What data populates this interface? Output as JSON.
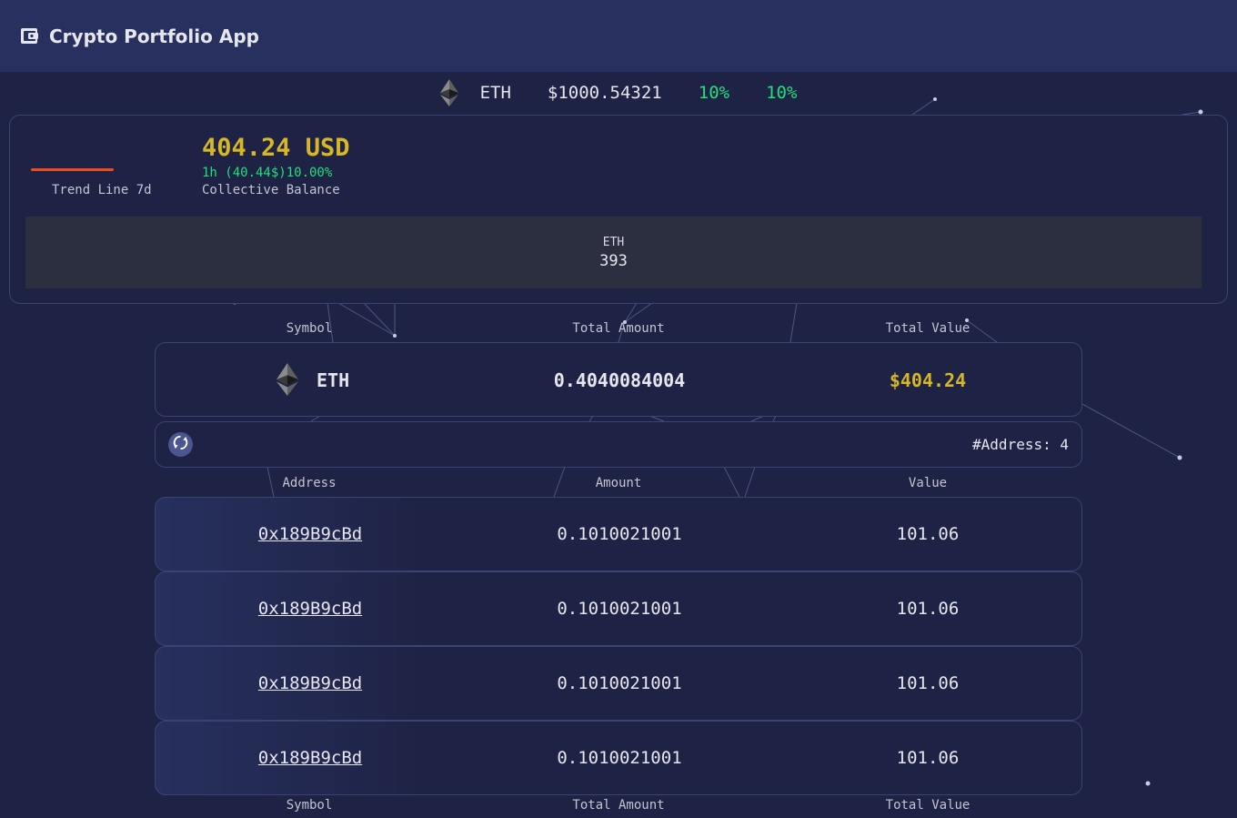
{
  "app": {
    "title": "Crypto Portfolio App",
    "icon": "wallet-icon"
  },
  "ticker": {
    "symbol": "ETH",
    "price": "$1000.54321",
    "change_1": "10%",
    "change_2": "10%",
    "icon": "ethereum-logo-icon"
  },
  "balance": {
    "trend_label": "Trend Line 7d",
    "value": "404.24 USD",
    "change": "1h (40.44$)10.00%",
    "label": "Collective Balance",
    "allocation": {
      "symbol": "ETH",
      "value": "393"
    }
  },
  "asset_table": {
    "headers": [
      "Symbol",
      "Total Amount",
      "Total Value"
    ],
    "row": {
      "symbol": "ETH",
      "total_amount": "0.4040084004",
      "total_value": "$404.24"
    }
  },
  "address_bar": {
    "count_label": "#Address: 4",
    "refresh_icon": "refresh-icon"
  },
  "address_table": {
    "headers": [
      "Address",
      "Amount",
      "Value"
    ],
    "rows": [
      {
        "address": "0x189B9cBd",
        "amount": "0.1010021001",
        "value": "101.06"
      },
      {
        "address": "0x189B9cBd",
        "amount": "0.1010021001",
        "value": "101.06"
      },
      {
        "address": "0x189B9cBd",
        "amount": "0.1010021001",
        "value": "101.06"
      },
      {
        "address": "0x189B9cBd",
        "amount": "0.1010021001",
        "value": "101.06"
      }
    ]
  },
  "footer_headers": [
    "Symbol",
    "Total Amount",
    "Total Value"
  ],
  "colors": {
    "background": "#1e2244",
    "header": "#27305e",
    "accent_gold": "#d5b824",
    "positive_green": "#22e07a",
    "trend_orange": "#ec4d1f"
  }
}
